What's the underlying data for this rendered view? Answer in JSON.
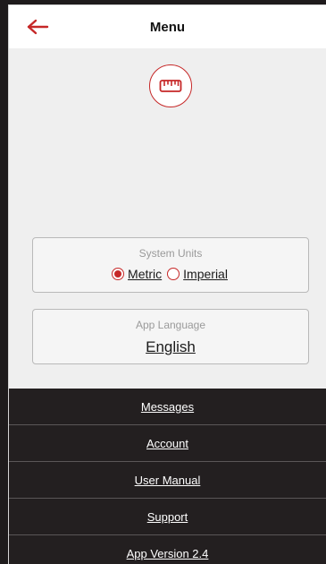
{
  "header": {
    "title": "Menu",
    "back_icon": "arrow-left-icon",
    "accent_color": "#c62828"
  },
  "badge": {
    "icon": "ruler-icon"
  },
  "system_units": {
    "label": "System Units",
    "options": [
      {
        "label": "Metric",
        "selected": true
      },
      {
        "label": "Imperial",
        "selected": false
      }
    ]
  },
  "app_language": {
    "label": "App Language",
    "value": "English"
  },
  "menu": {
    "items": [
      {
        "label": "Messages"
      },
      {
        "label": "Account"
      },
      {
        "label": "User Manual"
      },
      {
        "label": "Support"
      },
      {
        "label": "App Version 2.4"
      }
    ]
  }
}
